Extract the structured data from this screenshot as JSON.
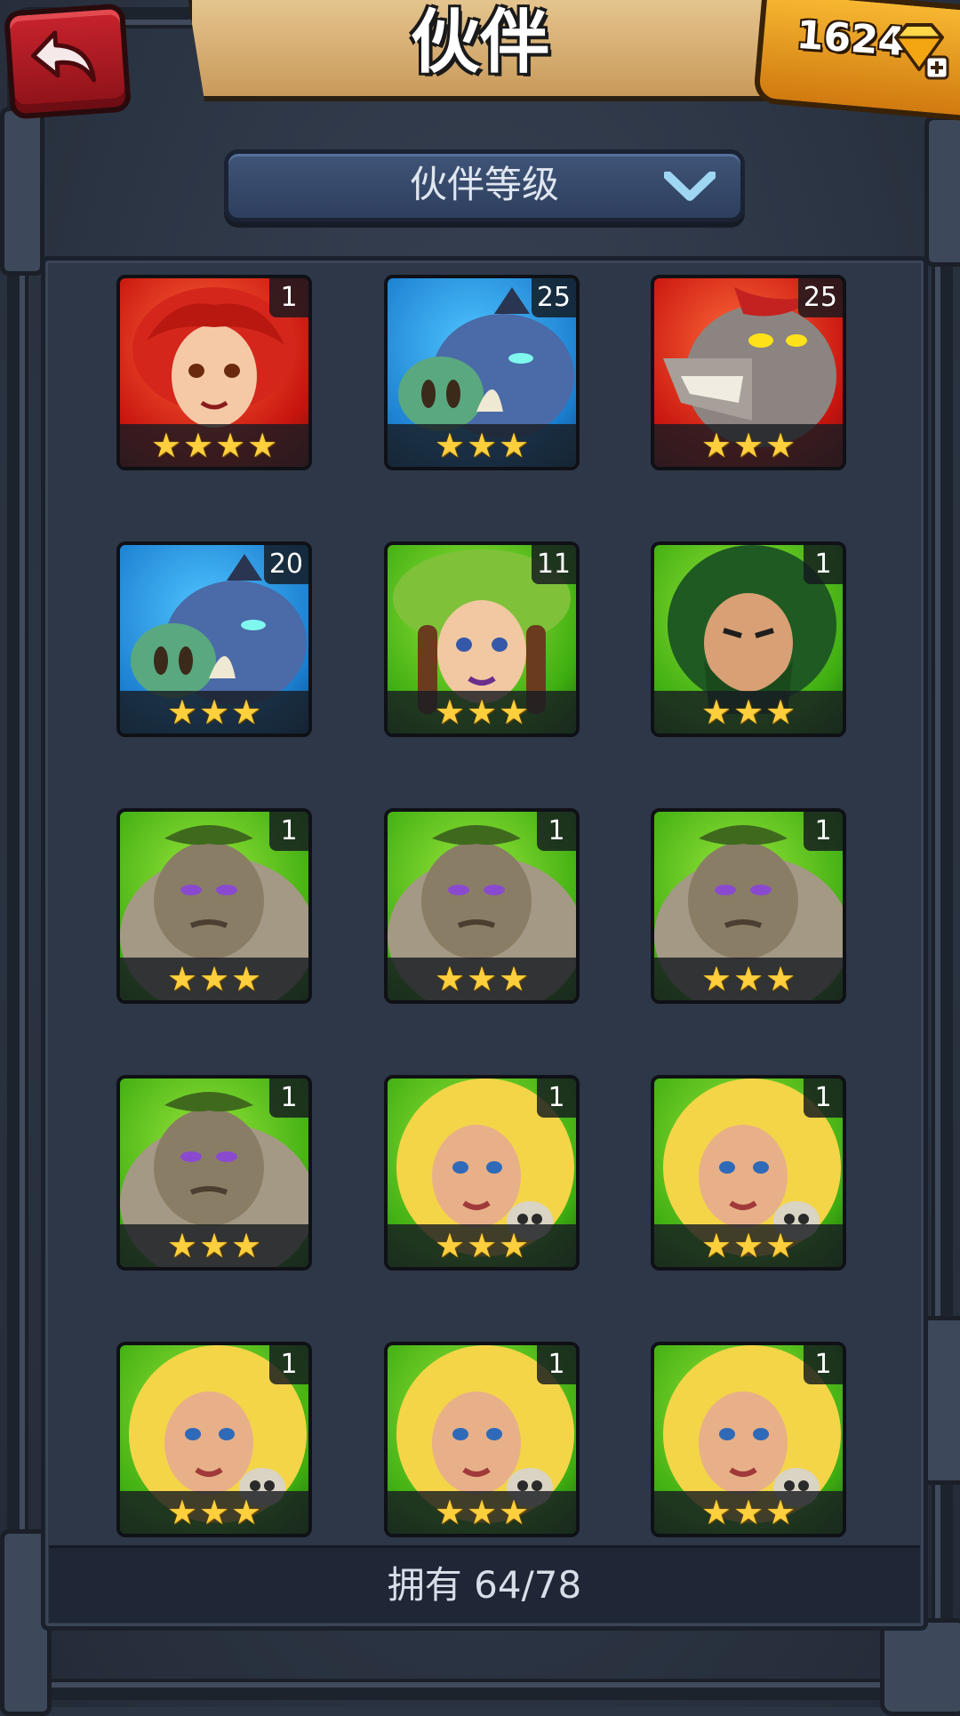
{
  "header": {
    "title": "伙伴",
    "gem_count": "16246",
    "back_icon": "back-arrow-icon",
    "gem_icon": "gem-plus-icon"
  },
  "filter": {
    "label": "伙伴等级",
    "icon": "chevron-down-icon"
  },
  "companions": [
    {
      "level": "1",
      "stars": 4,
      "color": "red",
      "portrait": "red-haired-warrior-woman"
    },
    {
      "level": "25",
      "stars": 3,
      "color": "blue",
      "portrait": "blue-boar-beast"
    },
    {
      "level": "25",
      "stars": 3,
      "color": "red",
      "portrait": "gray-werewolf"
    },
    {
      "level": "20",
      "stars": 3,
      "color": "blue",
      "portrait": "blue-boar-beast"
    },
    {
      "level": "11",
      "stars": 3,
      "color": "green",
      "portrait": "leaf-haired-elf-woman"
    },
    {
      "level": "1",
      "stars": 3,
      "color": "green",
      "portrait": "green-haired-bearded-man"
    },
    {
      "level": "1",
      "stars": 3,
      "color": "green",
      "portrait": "troll-brute"
    },
    {
      "level": "1",
      "stars": 3,
      "color": "green",
      "portrait": "troll-brute"
    },
    {
      "level": "1",
      "stars": 3,
      "color": "green",
      "portrait": "troll-brute"
    },
    {
      "level": "1",
      "stars": 3,
      "color": "green",
      "portrait": "troll-brute"
    },
    {
      "level": "1",
      "stars": 3,
      "color": "green",
      "portrait": "blonde-warrior-woman"
    },
    {
      "level": "1",
      "stars": 3,
      "color": "green",
      "portrait": "blonde-warrior-woman"
    },
    {
      "level": "1",
      "stars": 3,
      "color": "green",
      "portrait": "blonde-warrior-woman"
    },
    {
      "level": "1",
      "stars": 3,
      "color": "green",
      "portrait": "blonde-warrior-woman"
    },
    {
      "level": "1",
      "stars": 3,
      "color": "green",
      "portrait": "blonde-warrior-woman"
    }
  ],
  "footer": {
    "owned_text": "拥有 64/78"
  },
  "colors": {
    "panel": "#2e3748",
    "star": "#ffcf3d",
    "title_banner": "#e7c893",
    "gem_box": "#f7b731",
    "back_button": "#c8232c"
  }
}
